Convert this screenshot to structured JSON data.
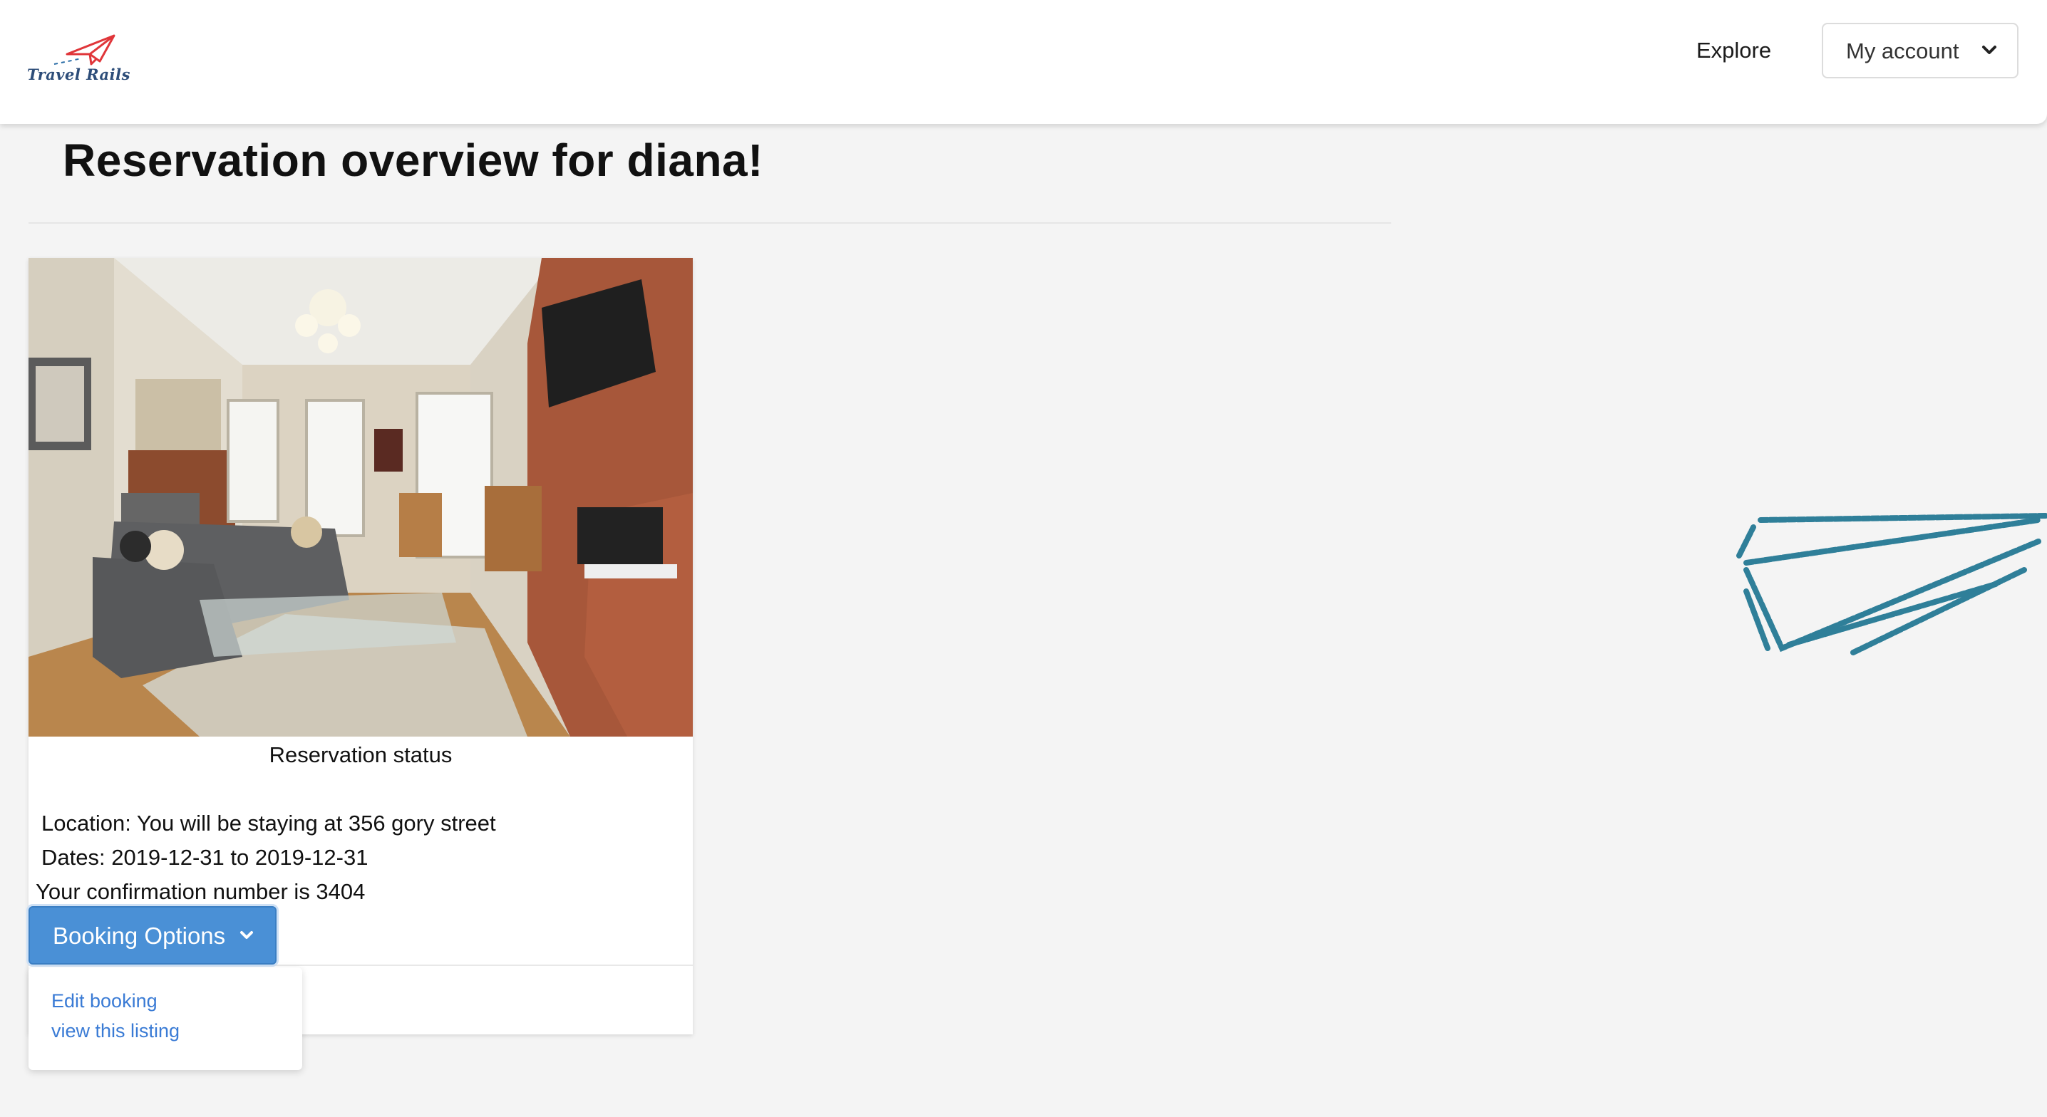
{
  "brand": {
    "name": "Travel Rails"
  },
  "nav": {
    "explore_label": "Explore",
    "account_label": "My account"
  },
  "page": {
    "title": "Reservation overview for diana!"
  },
  "reservation": {
    "status_label": "Reservation status",
    "location": "Location: You will be staying at 356 gory street",
    "dates": "Dates: 2019-12-31 to 2019-12-31",
    "confirmation": "Your confirmation number is 3404",
    "booking_options_label": "Booking Options",
    "menu": [
      {
        "label": "Edit booking"
      },
      {
        "label": "view this listing"
      }
    ]
  },
  "colors": {
    "accent": "#4a90d6",
    "link": "#3a7bd5",
    "logo_plane": "#e0363a",
    "logo_text": "#2d4d79",
    "deco_plane": "#2f7f99"
  },
  "icons": {
    "logo": "paper-plane-icon",
    "account_dropdown": "chevron-down-icon",
    "booking_dropdown": "chevron-down-icon",
    "decoration": "paper-plane-icon"
  }
}
